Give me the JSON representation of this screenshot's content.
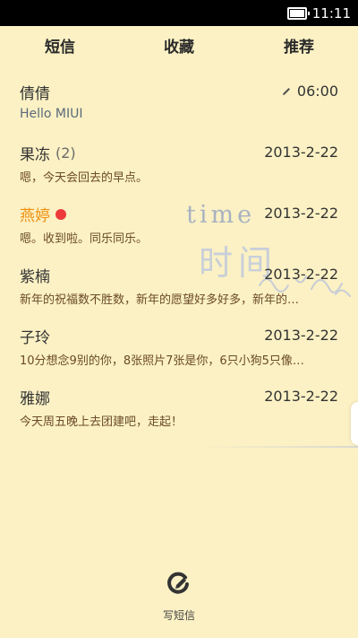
{
  "status_bar": {
    "time": "11:11"
  },
  "tabs": [
    {
      "label": "短信"
    },
    {
      "label": "收藏"
    },
    {
      "label": "推荐"
    }
  ],
  "background": {
    "deco_text_en": "time",
    "deco_text_cn": "时间"
  },
  "conversations": [
    {
      "name": "倩倩",
      "date": "06:00",
      "preview": "Hello MIUI",
      "count": "",
      "unread": false,
      "draft": true
    },
    {
      "name": "果冻",
      "count": "(2)",
      "date": "2013-2-22",
      "preview": "嗯，今天会回去的早点。",
      "unread": false,
      "draft": false
    },
    {
      "name": "燕婷",
      "count": "",
      "date": "2013-2-22",
      "preview": "嗯。收到啦。同乐同乐。",
      "unread": true,
      "draft": false
    },
    {
      "name": "紫楠",
      "count": "",
      "date": "2013-2-22",
      "preview": "新年的祝福数不胜数，新年的愿望好多好多，新年的…",
      "unread": false,
      "draft": false
    },
    {
      "name": "子玲",
      "count": "",
      "date": "2013-2-22",
      "preview": "10分想念9别的你，8张照片7张是你，6只小狗5只像…",
      "unread": false,
      "draft": false
    },
    {
      "name": "雅娜",
      "count": "",
      "date": "2013-2-22",
      "preview": "今天周五晚上去团建吧，走起！",
      "unread": false,
      "draft": false
    }
  ],
  "compose": {
    "label": "写短信",
    "icon": "compose-icon"
  },
  "colors": {
    "background": "#fbf1c4",
    "unread_name": "#f0900f",
    "unread_dot": "#ee3a3a"
  }
}
